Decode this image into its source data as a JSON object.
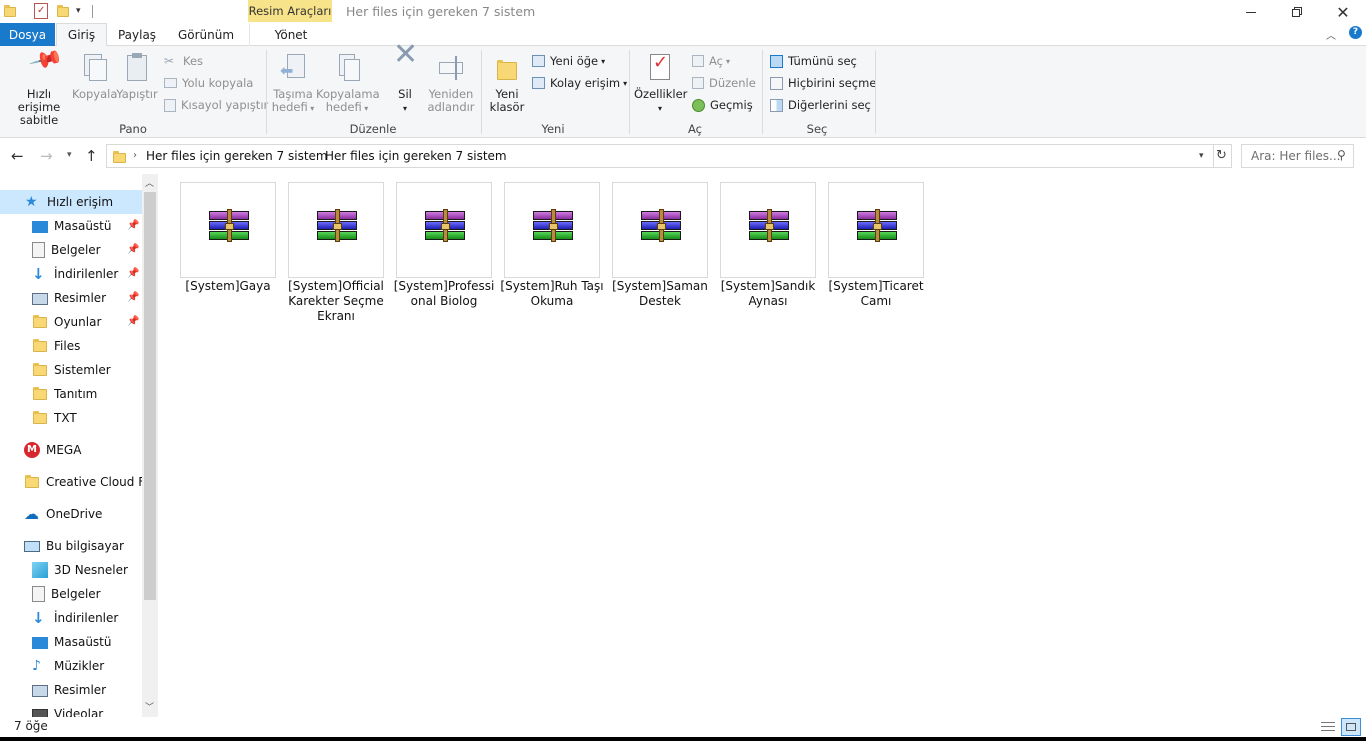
{
  "window": {
    "title": "Her files için gereken 7 sistem",
    "contextual_tab": "Resim Araçları",
    "controls": [
      "minimize",
      "restore",
      "close"
    ]
  },
  "tabs": {
    "file": "Dosya",
    "home": "Giriş",
    "share": "Paylaş",
    "view": "Görünüm",
    "manage": "Yönet"
  },
  "ribbon": {
    "pano": {
      "label": "Pano",
      "pin": "Hızlı erişime sabitle",
      "copy": "Kopyala",
      "paste": "Yapıştır",
      "cut": "Kes",
      "copy_path": "Yolu kopyala",
      "paste_shortcut": "Kısayol yapıştır"
    },
    "duzenle": {
      "label": "Düzenle",
      "move_to_1": "Taşıma",
      "move_to_2": "hedefi",
      "copy_to_1": "Kopyalama",
      "copy_to_2": "hedefi",
      "delete": "Sil",
      "rename_1": "Yeniden",
      "rename_2": "adlandır"
    },
    "yeni": {
      "label": "Yeni",
      "new_folder_1": "Yeni",
      "new_folder_2": "klasör",
      "new_item": "Yeni öğe",
      "easy_access": "Kolay erişim"
    },
    "ac": {
      "label": "Aç",
      "properties": "Özellikler",
      "open": "Aç",
      "edit": "Düzenle",
      "history": "Geçmiş"
    },
    "sec": {
      "label": "Seç",
      "select_all": "Tümünü seç",
      "select_none": "Hiçbirini seçme",
      "invert": "Diğerlerini seç"
    }
  },
  "address": {
    "crumbs": [
      "Her files için gereken 7 sistem",
      "Her files için gereken 7 sistem"
    ],
    "search_placeholder": "Ara: Her files..."
  },
  "sidebar": {
    "quick_access": "Hızlı erişim",
    "quick_items": [
      {
        "label": "Masaüstü",
        "icon": "desktop-icon",
        "pinned": true
      },
      {
        "label": "Belgeler",
        "icon": "documents-icon",
        "pinned": true
      },
      {
        "label": "İndirilenler",
        "icon": "downloads-icon",
        "pinned": true
      },
      {
        "label": "Resimler",
        "icon": "pictures-icon",
        "pinned": true
      },
      {
        "label": "Oyunlar",
        "icon": "folder-icon",
        "pinned": true
      },
      {
        "label": "Files",
        "icon": "folder-icon",
        "pinned": false
      },
      {
        "label": "Sistemler",
        "icon": "folder-icon",
        "pinned": false
      },
      {
        "label": "Tanıtım",
        "icon": "folder-icon",
        "pinned": false
      },
      {
        "label": "TXT",
        "icon": "folder-icon",
        "pinned": false
      }
    ],
    "mega": "MEGA",
    "creative_cloud": "Creative Cloud Files",
    "onedrive": "OneDrive",
    "this_pc": "Bu bilgisayar",
    "pc_items": [
      {
        "label": "3D Nesneler",
        "icon": "3d-objects-icon"
      },
      {
        "label": "Belgeler",
        "icon": "documents-icon"
      },
      {
        "label": "İndirilenler",
        "icon": "downloads-icon"
      },
      {
        "label": "Masaüstü",
        "icon": "desktop-icon"
      },
      {
        "label": "Müzikler",
        "icon": "music-icon"
      },
      {
        "label": "Resimler",
        "icon": "pictures-icon"
      },
      {
        "label": "Videolar",
        "icon": "videos-icon"
      }
    ]
  },
  "files": [
    {
      "name": "[System]Gaya",
      "icon": "winrar-archive-icon"
    },
    {
      "name": "[System]Official Karekter Seçme Ekranı",
      "icon": "winrar-archive-icon"
    },
    {
      "name": "[System]Professional Biolog",
      "icon": "winrar-archive-icon"
    },
    {
      "name": "[System]Ruh Taşı Okuma",
      "icon": "winrar-archive-icon"
    },
    {
      "name": "[System]Saman Destek",
      "icon": "winrar-archive-icon"
    },
    {
      "name": "[System]Sandık Aynası",
      "icon": "winrar-archive-icon"
    },
    {
      "name": "[System]Ticaret Camı",
      "icon": "winrar-archive-icon"
    }
  ],
  "file_labels": [
    [
      "[System]Gaya"
    ],
    [
      "[System]Official",
      "Karekter Seçme",
      "Ekranı"
    ],
    [
      "[System]Professi",
      "onal Biolog"
    ],
    [
      "[System]Ruh Taşı",
      "Okuma"
    ],
    [
      "[System]Saman",
      "Destek"
    ],
    [
      "[System]Sandık",
      "Aynası"
    ],
    [
      "[System]Ticaret",
      "Camı"
    ]
  ],
  "status": {
    "count": "7 öğe"
  },
  "colors": {
    "accent": "#1979ca",
    "contextual_tab": "#f6e38a",
    "selected_nav": "#cce8ff"
  }
}
